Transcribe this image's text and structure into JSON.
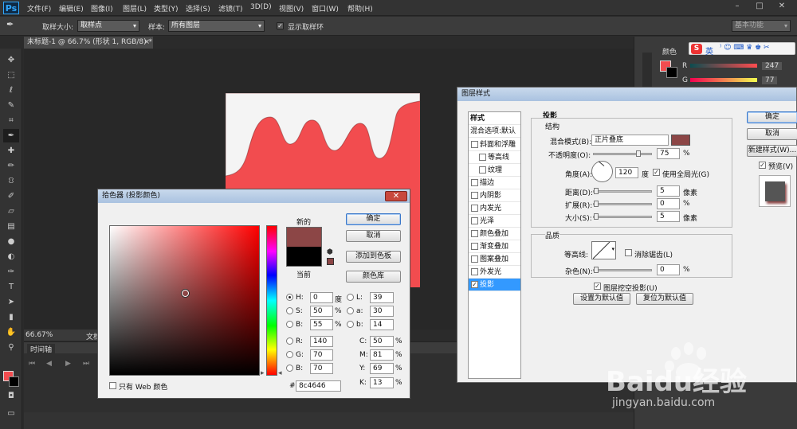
{
  "app": {
    "logo": "Ps"
  },
  "menu": [
    "文件(F)",
    "编辑(E)",
    "图像(I)",
    "图层(L)",
    "类型(Y)",
    "选择(S)",
    "滤镜(T)",
    "3D(D)",
    "视图(V)",
    "窗口(W)",
    "帮助(H)"
  ],
  "window_controls": {
    "minimize": "–",
    "maximize": "□",
    "close": "✕"
  },
  "options": {
    "sample_size_label": "取样大小:",
    "sample_size_value": "取样点",
    "sample_label": "样本:",
    "sample_value": "所有图层",
    "show_ring_label": "显示取样环",
    "workspace": "基本功能"
  },
  "document": {
    "tab": "未标题-1 @ 66.7% (形状 1, RGB/8) *",
    "close": "×"
  },
  "status": {
    "zoom": "66.67%",
    "doc": "文档"
  },
  "timeline": {
    "title": "时间轴"
  },
  "right_panel": {
    "tab_color": "颜色",
    "r_label": "R",
    "g_label": "G",
    "r_value": "247",
    "g_value": "77"
  },
  "ime_bar": {
    "label": "英"
  },
  "picker": {
    "title": "拾色器 (投影颜色)",
    "new_label": "新的",
    "current_label": "当前",
    "new_color": "#8c4646",
    "current_color": "#000000",
    "ok": "确定",
    "cancel": "取消",
    "add_swatch": "添加到色板",
    "color_libraries": "颜色库",
    "h_label": "H:",
    "h_value": "0",
    "h_unit": "度",
    "s_label": "S:",
    "s_value": "50",
    "s_unit": "%",
    "b_label": "B:",
    "b_value": "55",
    "b_unit": "%",
    "r_label": "R:",
    "r_value": "140",
    "g_label": "G:",
    "g_value": "70",
    "bl_label": "B:",
    "bl_value": "70",
    "l_label": "L:",
    "l_value": "39",
    "a_label": "a:",
    "a_value": "30",
    "lb_label": "b:",
    "lb_value": "14",
    "c_label": "C:",
    "c_value": "50",
    "c_unit": "%",
    "m_label": "M:",
    "m_value": "81",
    "m_unit": "%",
    "y_label": "Y:",
    "y_value": "69",
    "y_unit": "%",
    "k_label": "K:",
    "k_value": "13",
    "k_unit": "%",
    "hex_label": "#",
    "hex_value": "8c4646",
    "web_only": "只有 Web 颜色"
  },
  "layer_style": {
    "title": "图层样式",
    "styles_header": "样式",
    "blend_default": "混合选项:默认",
    "effects": [
      {
        "label": "斜面和浮雕",
        "checked": false,
        "indent": false
      },
      {
        "label": "等高线",
        "checked": false,
        "indent": true
      },
      {
        "label": "纹理",
        "checked": false,
        "indent": true
      },
      {
        "label": "描边",
        "checked": false,
        "indent": false
      },
      {
        "label": "内阴影",
        "checked": false,
        "indent": false
      },
      {
        "label": "内发光",
        "checked": false,
        "indent": false
      },
      {
        "label": "光泽",
        "checked": false,
        "indent": false
      },
      {
        "label": "颜色叠加",
        "checked": false,
        "indent": false
      },
      {
        "label": "渐变叠加",
        "checked": false,
        "indent": false
      },
      {
        "label": "图案叠加",
        "checked": false,
        "indent": false
      },
      {
        "label": "外发光",
        "checked": false,
        "indent": false
      },
      {
        "label": "投影",
        "checked": true,
        "indent": false
      }
    ],
    "section": "投影",
    "structure": "结构",
    "blend_mode_label": "混合模式(B):",
    "blend_mode_value": "正片叠底",
    "shadow_color": "#8c4646",
    "opacity_label": "不透明度(O):",
    "opacity_value": "75",
    "percent": "%",
    "angle_label": "角度(A):",
    "angle_value": "120",
    "degree": "度",
    "global_light": "使用全局光(G)",
    "distance_label": "距离(D):",
    "distance_value": "5",
    "spread_label": "扩展(R):",
    "spread_value": "0",
    "size_label": "大小(S):",
    "size_value": "5",
    "px": "像素",
    "quality": "品质",
    "contour_label": "等高线:",
    "anti_alias": "消除锯齿(L)",
    "noise_label": "杂色(N):",
    "noise_value": "0",
    "knockout": "图层挖空投影(U)",
    "make_default": "设置为默认值",
    "reset_default": "复位为默认值",
    "ok": "确定",
    "cancel": "取消",
    "new_style": "新建样式(W)...",
    "preview": "预览(V)"
  },
  "watermark": {
    "brand": "Baidu经验",
    "url": "jingyan.baidu.com"
  },
  "colors": {
    "canvas_red": "#f24c4f",
    "fg": "#f24c4f",
    "bg": "#000000"
  }
}
